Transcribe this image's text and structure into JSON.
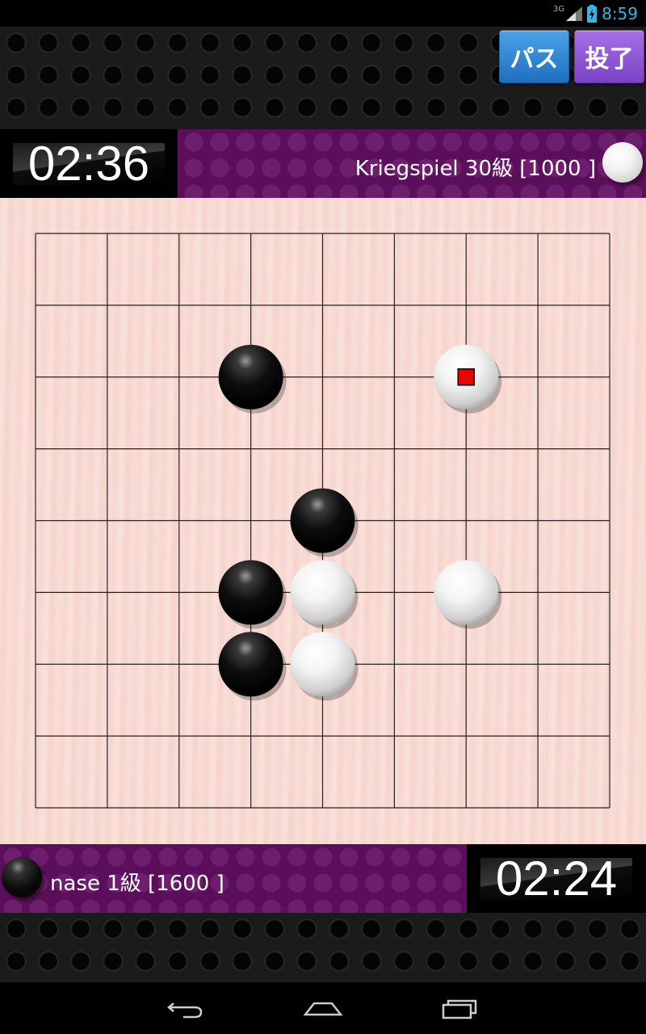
{
  "status_bar": {
    "network": "3G",
    "time": "8:59"
  },
  "buttons": {
    "pass": "パス",
    "resign": "投了"
  },
  "opponent": {
    "timer": "02:36",
    "name": "Kriegspiel 30級 [1000 ]",
    "stone_color": "white"
  },
  "player": {
    "timer": "02:24",
    "name": "nase 1級 [1600 ]",
    "stone_color": "black"
  },
  "board": {
    "size": 9,
    "stones": [
      {
        "col": 3,
        "row": 2,
        "color": "black"
      },
      {
        "col": 6,
        "row": 2,
        "color": "white",
        "last_move": true
      },
      {
        "col": 4,
        "row": 4,
        "color": "black"
      },
      {
        "col": 3,
        "row": 5,
        "color": "black"
      },
      {
        "col": 4,
        "row": 5,
        "color": "white"
      },
      {
        "col": 6,
        "row": 5,
        "color": "white"
      },
      {
        "col": 3,
        "row": 6,
        "color": "black"
      },
      {
        "col": 4,
        "row": 6,
        "color": "white"
      }
    ]
  },
  "colors": {
    "player_bar": "#5b0f5b",
    "last_move_marker": "#ee0000",
    "board_line": "#222222"
  },
  "nav": {
    "back_icon": "back-icon",
    "home_icon": "home-icon",
    "recent_icon": "recent-apps-icon"
  }
}
